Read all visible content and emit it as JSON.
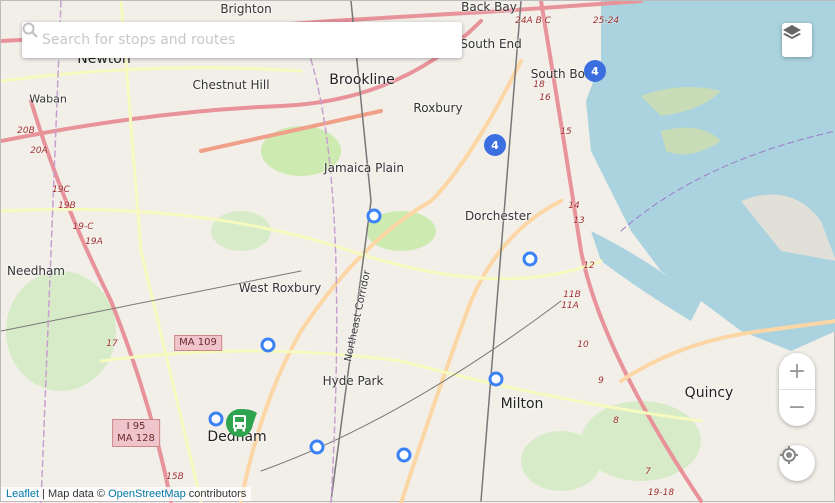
{
  "search": {
    "placeholder": "Search for stops and routes",
    "value": ""
  },
  "places": [
    {
      "name": "Brighton"
    },
    {
      "name": "Back Bay"
    },
    {
      "name": "South End"
    },
    {
      "name": "Newton"
    },
    {
      "name": "Brookline"
    },
    {
      "name": "Chestnut Hill"
    },
    {
      "name": "Waban"
    },
    {
      "name": "Roxbury"
    },
    {
      "name": "South Bos"
    },
    {
      "name": "Jamaica Plain"
    },
    {
      "name": "Dorchester"
    },
    {
      "name": "Needham"
    },
    {
      "name": "West Roxbury"
    },
    {
      "name": "Hyde Park"
    },
    {
      "name": "Milton"
    },
    {
      "name": "Quincy"
    },
    {
      "name": "Dedham"
    },
    {
      "name": "Northeast Corridor"
    }
  ],
  "road_numbers": [
    "20B",
    "20A",
    "19C",
    "19B",
    "19-C",
    "19A",
    "17",
    "15B",
    "18",
    "16",
    "15",
    "14",
    "13",
    "12",
    "11B",
    "11A",
    "10",
    "9",
    "8",
    "7",
    "24A B C",
    "25-24",
    "19-18"
  ],
  "shields": {
    "ma109": "MA 109",
    "i95": "I 95",
    "ma128": "MA 128"
  },
  "clusters": [
    {
      "count": "4"
    },
    {
      "count": "4"
    }
  ],
  "controls": {
    "zoom_in": "+",
    "zoom_out": "−"
  },
  "attribution": {
    "leaflet": "Leaflet",
    "sep": " | Map data © ",
    "osm": "OpenStreetMap",
    "tail": " contributors"
  },
  "colors": {
    "land": "#f2efe9",
    "water": "#aad3df",
    "stop": "#3b82f6",
    "cluster": "#3b6fe0",
    "bus": "#2ea44f"
  }
}
